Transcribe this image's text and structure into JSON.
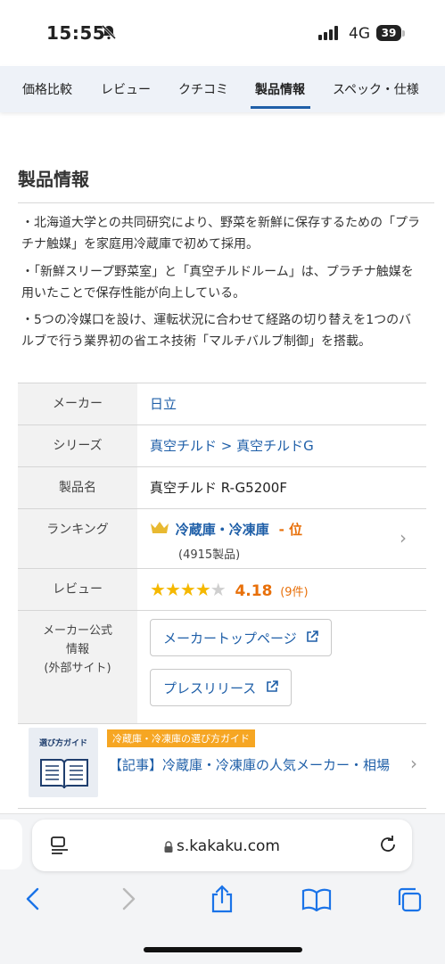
{
  "status": {
    "time": "15:55",
    "network": "4G",
    "battery": "39"
  },
  "tabs": [
    "価格比較",
    "レビュー",
    "クチコミ",
    "製品情報",
    "スペック・仕様"
  ],
  "section_title": "製品情報",
  "bullets": [
    "・北海道大学との共同研究により、野菜を新鮮に保存するための「プラチナ触媒」を家庭用冷蔵庫で初めて採用。",
    "・「新鮮スリープ野菜室」と「真空チルドルーム」は、プラチナ触媒を用いたことで保存性能が向上している。",
    "・5つの冷媒口を設け、運転状況に合わせて経路の切り替えを1つのバルブで行う業界初の省エネ技術「マルチバルブ制御」を搭載。"
  ],
  "spec": {
    "maker_label": "メーカー",
    "maker_value": "日立",
    "series_label": "シリーズ",
    "series_value_1": "真空チルド",
    "series_sep": ">",
    "series_value_2": "真空チルドG",
    "product_label": "製品名",
    "product_value": "真空チルド R-G5200F",
    "ranking_label": "ランキング",
    "ranking_category": "冷蔵庫・冷凍庫",
    "ranking_position": "- 位",
    "ranking_count": "(4915製品)",
    "review_label": "レビュー",
    "review_score": "4.18",
    "review_stars": 4,
    "review_count": "(9件)",
    "official_label_1": "メーカー公式",
    "official_label_2": "情報",
    "official_label_3": "(外部サイト)",
    "button_top": "メーカートップページ",
    "button_press": "プレスリリース"
  },
  "guide": {
    "thumb_label": "選び方ガイド",
    "tag": "冷蔵庫・冷凍庫の選び方ガイド",
    "title": "【記事】冷蔵庫・冷凍庫の人気メーカー・相場"
  },
  "browser": {
    "url": "s.kakaku.com"
  },
  "colors": {
    "link": "#1f5fa8",
    "accent_orange": "#e8700a",
    "tag_orange": "#f6a623",
    "star": "#f5b800"
  }
}
